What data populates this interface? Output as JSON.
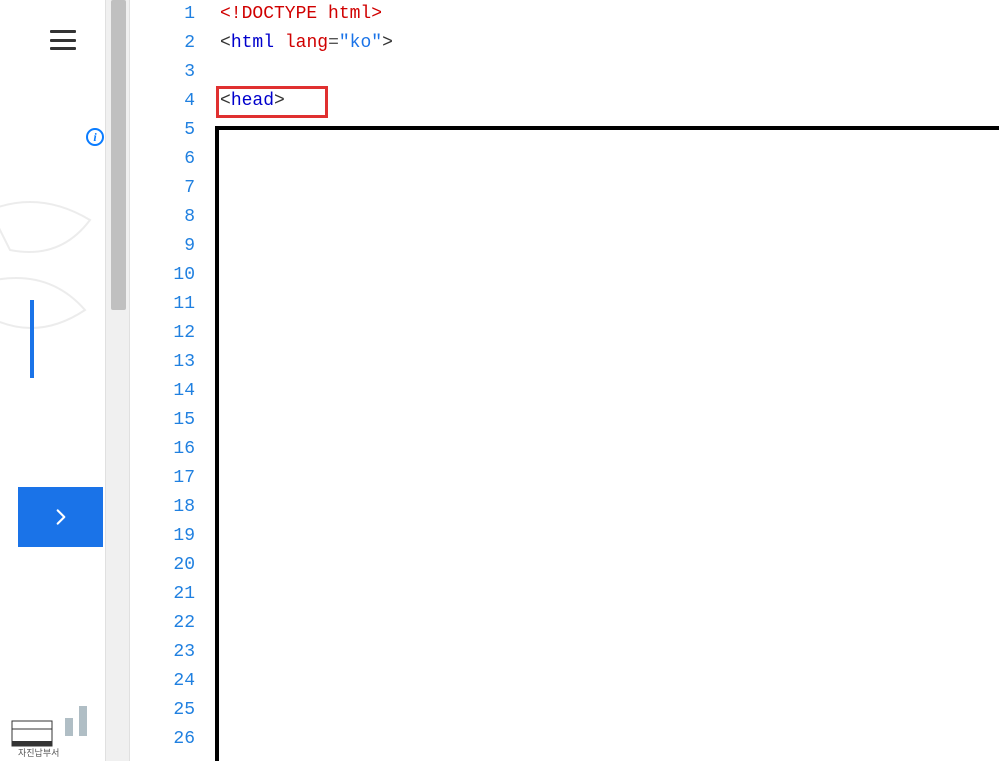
{
  "editor": {
    "line_numbers": [
      "1",
      "2",
      "3",
      "4",
      "5",
      "6",
      "7",
      "8",
      "9",
      "10",
      "11",
      "12",
      "13",
      "14",
      "15",
      "16",
      "17",
      "18",
      "19",
      "20",
      "21",
      "22",
      "23",
      "24",
      "25",
      "26"
    ],
    "lines": {
      "l1": {
        "doctype": "<!DOCTYPE html>"
      },
      "l2": {
        "open": "<",
        "tag": "html",
        "space": " ",
        "attr": "lang",
        "eq": "=",
        "val": "\"ko\"",
        "close": ">"
      },
      "l4": {
        "open": "<",
        "tag": "head",
        "close": ">"
      }
    }
  },
  "left_panel": {
    "bottom_label": "자진납부서",
    "info_icon": "i"
  },
  "highlight": {
    "target_line": 4,
    "target_text": "<head>"
  }
}
